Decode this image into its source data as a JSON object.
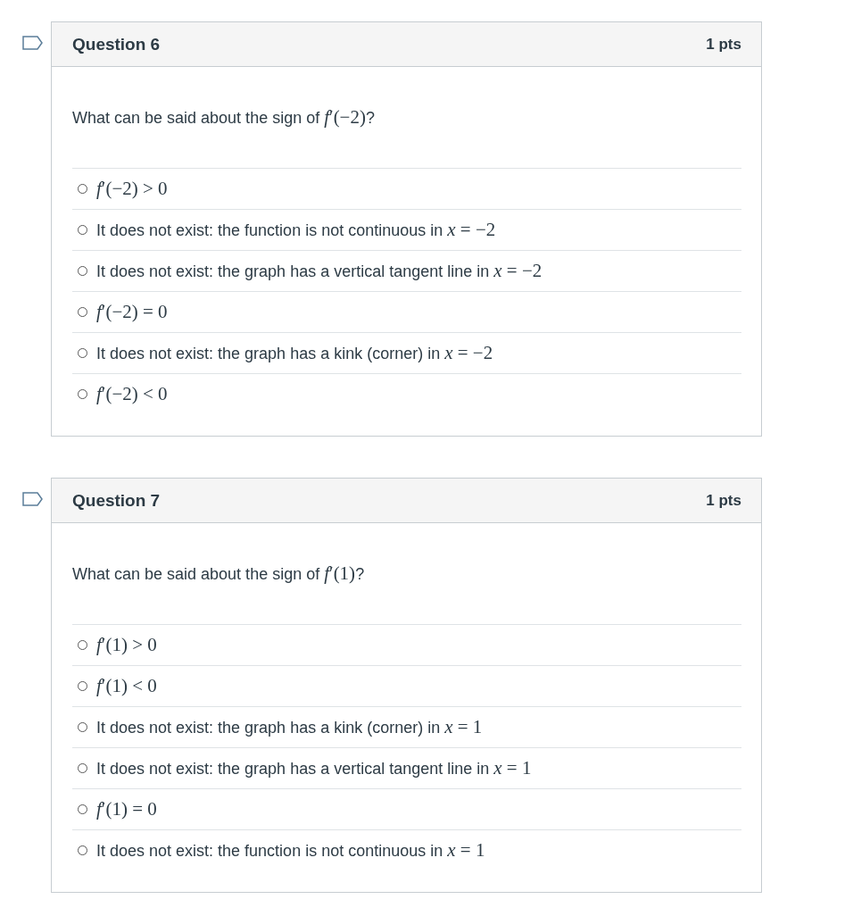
{
  "questions": [
    {
      "title": "Question 6",
      "points": "1 pts",
      "flagged": false,
      "prompt": "What can be said about the sign of ",
      "prompt_math": "*f*′(−2)",
      "prompt_end": "?",
      "options": [
        {
          "math": "*f*′(−2) > 0",
          "selected": false
        },
        {
          "text": "It does not exist: the function is not continuous in ",
          "math": "*x* = −2",
          "selected": false
        },
        {
          "text": "It does not exist: the graph has a vertical tangent line in ",
          "math": "*x* = −2",
          "selected": false
        },
        {
          "math": "*f*′(−2) = 0",
          "selected": false
        },
        {
          "text": "It does not exist: the graph has a kink (corner) in ",
          "math": "*x* = −2",
          "selected": false
        },
        {
          "math": "*f*′(−2) < 0",
          "selected": false
        }
      ]
    },
    {
      "title": "Question 7",
      "points": "1 pts",
      "flagged": false,
      "prompt": "What can be said about the sign of ",
      "prompt_math": "*f*′(1)",
      "prompt_end": "?",
      "options": [
        {
          "math": "*f*′(1) > 0",
          "selected": false
        },
        {
          "math": "*f*′(1) < 0",
          "selected": false
        },
        {
          "text": "It does not exist: the graph has a kink (corner) in ",
          "math": "*x* = 1",
          "selected": false
        },
        {
          "text": "It does not exist: the graph has a vertical tangent line in ",
          "math": "*x* = 1",
          "selected": false
        },
        {
          "math": "*f*′(1) = 0",
          "selected": false
        },
        {
          "text": "It does not exist: the function is not continuous in ",
          "math": "*x* = 1",
          "selected": false
        }
      ]
    }
  ]
}
